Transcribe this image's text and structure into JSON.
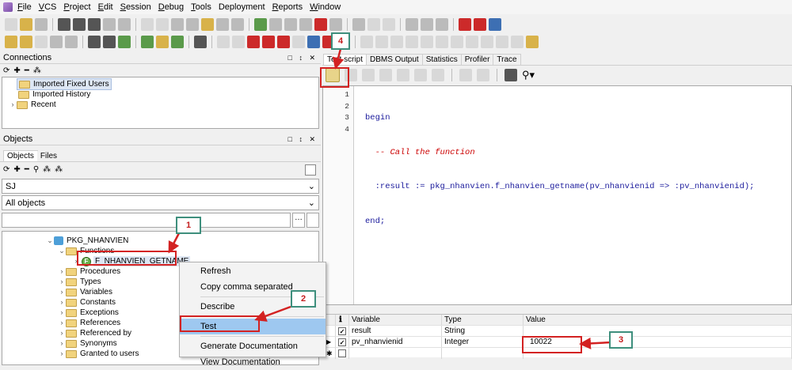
{
  "menubar": {
    "items": [
      {
        "u": "F",
        "rest": "ile"
      },
      {
        "u": "V",
        "rest": "CS"
      },
      {
        "u": "P",
        "rest": "roject"
      },
      {
        "u": "E",
        "rest": "dit"
      },
      {
        "u": "S",
        "rest": "ession"
      },
      {
        "u": "D",
        "rest": "ebug"
      },
      {
        "u": "T",
        "rest": "ools"
      },
      {
        "u": "",
        "rest": "Deployment"
      },
      {
        "u": "R",
        "rest": "eports"
      },
      {
        "u": "W",
        "rest": "indow"
      }
    ]
  },
  "connections": {
    "title": "Connections",
    "controls": "□ ↕ ✕",
    "items": [
      "Imported Fixed Users",
      "Imported History",
      "Recent"
    ]
  },
  "objects": {
    "title": "Objects",
    "controls": "□ ↕ ✕",
    "tabs": [
      "Objects",
      "Files"
    ],
    "schema": "SJ",
    "filter": "All objects",
    "search_value": "",
    "tree": {
      "package": "PKG_NHANVIEN",
      "functions_folder": "Functions",
      "function": "F_NHANVIEN_GETNAME",
      "folders": [
        "Procedures",
        "Types",
        "Variables",
        "Constants",
        "Exceptions",
        "References",
        "Referenced by",
        "Synonyms",
        "Granted to users"
      ]
    }
  },
  "context_menu": {
    "items": [
      "Refresh",
      "Copy comma separated",
      "Describe",
      "Test",
      "Generate Documentation",
      "View Documentation"
    ]
  },
  "editor": {
    "tabs": [
      "Test script",
      "DBMS Output",
      "Statistics",
      "Profiler",
      "Trace"
    ],
    "line_numbers": [
      "1",
      "2",
      "3",
      "4"
    ],
    "lines": {
      "l1": "begin",
      "l2": "  -- Call the function",
      "l3": "  :result := pkg_nhanvien.f_nhanvien_getname(pv_nhanvienid => :pv_nhanvienid);",
      "l4": "end;"
    }
  },
  "variables_grid": {
    "headers": [
      "Variable",
      "Type",
      "Value"
    ],
    "rows": [
      {
        "variable": "result",
        "type": "String",
        "value": ""
      },
      {
        "variable": "pv_nhanvienid",
        "type": "Integer",
        "value": "10022"
      }
    ]
  },
  "annotations": {
    "callouts": [
      "1",
      "2",
      "3",
      "4"
    ]
  }
}
